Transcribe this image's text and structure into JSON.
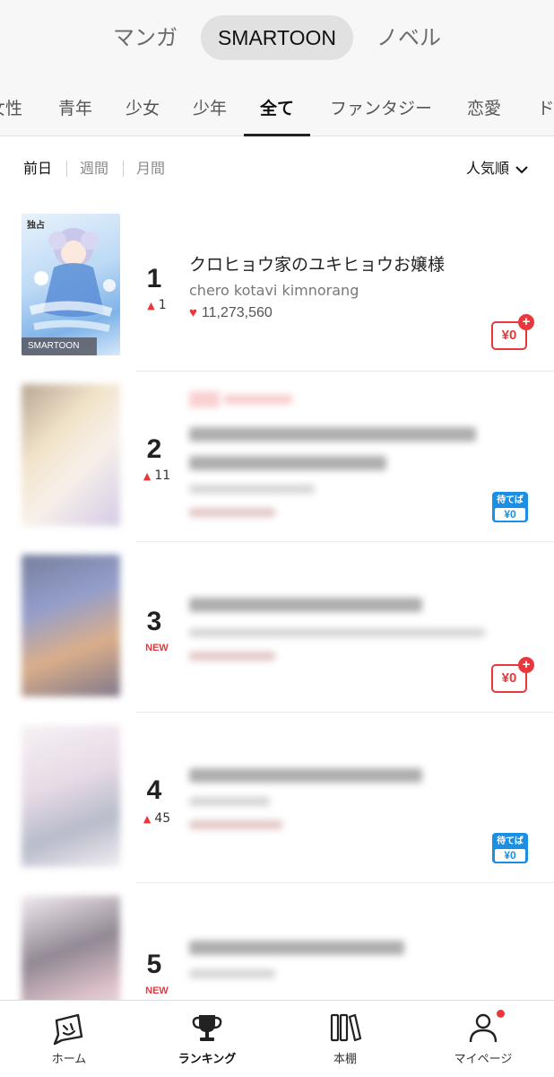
{
  "main_tabs": [
    {
      "label": "マンガ",
      "active": false
    },
    {
      "label": "SMARTOON",
      "active": true
    },
    {
      "label": "ノベル",
      "active": false
    }
  ],
  "genre_tabs": [
    {
      "label": "女性",
      "active": false
    },
    {
      "label": "青年",
      "active": false
    },
    {
      "label": "少女",
      "active": false
    },
    {
      "label": "少年",
      "active": false
    },
    {
      "label": "全て",
      "active": true
    },
    {
      "label": "ファンタジー",
      "active": false
    },
    {
      "label": "恋愛",
      "active": false
    },
    {
      "label": "ド",
      "active": false
    }
  ],
  "period_tabs": [
    {
      "label": "前日",
      "active": true
    },
    {
      "label": "週間",
      "active": false
    },
    {
      "label": "月間",
      "active": false
    }
  ],
  "sort": {
    "label": "人気順",
    "icon": "chevron-down-icon"
  },
  "ranking": [
    {
      "rank": "1",
      "change": "1",
      "change_type": "up",
      "title": "クロヒョウ家のユキヒョウお嬢様",
      "author": "chero kotavi kimnorang",
      "likes": "11,273,560",
      "badge": "free",
      "badge_text": "¥0",
      "thumb_exclusive": "独占",
      "thumb_label": "SMARTOON",
      "blurred": false
    },
    {
      "rank": "2",
      "change": "11",
      "change_type": "up",
      "title": "",
      "author": "",
      "likes": "",
      "badge": "wait",
      "badge_text": "¥0",
      "badge_top": "待てば",
      "blurred": true
    },
    {
      "rank": "3",
      "change": "NEW",
      "change_type": "new",
      "title": "",
      "author": "",
      "likes": "",
      "badge": "free",
      "badge_text": "¥0",
      "blurred": true
    },
    {
      "rank": "4",
      "change": "45",
      "change_type": "up",
      "title": "",
      "author": "",
      "likes": "",
      "badge": "wait",
      "badge_text": "¥0",
      "badge_top": "待てば",
      "blurred": true
    },
    {
      "rank": "5",
      "change": "NEW",
      "change_type": "new",
      "title": "",
      "author": "",
      "likes": "",
      "badge": "none",
      "blurred": true
    }
  ],
  "bottom_nav": [
    {
      "label": "ホーム",
      "icon": "home-icon",
      "active": false
    },
    {
      "label": "ランキング",
      "icon": "trophy-icon",
      "active": true
    },
    {
      "label": "本棚",
      "icon": "bookshelf-icon",
      "active": false
    },
    {
      "label": "マイページ",
      "icon": "user-icon",
      "active": false,
      "notification": true
    }
  ],
  "colors": {
    "accent_red": "#e8383d",
    "wait_blue": "#1a8fe3"
  }
}
